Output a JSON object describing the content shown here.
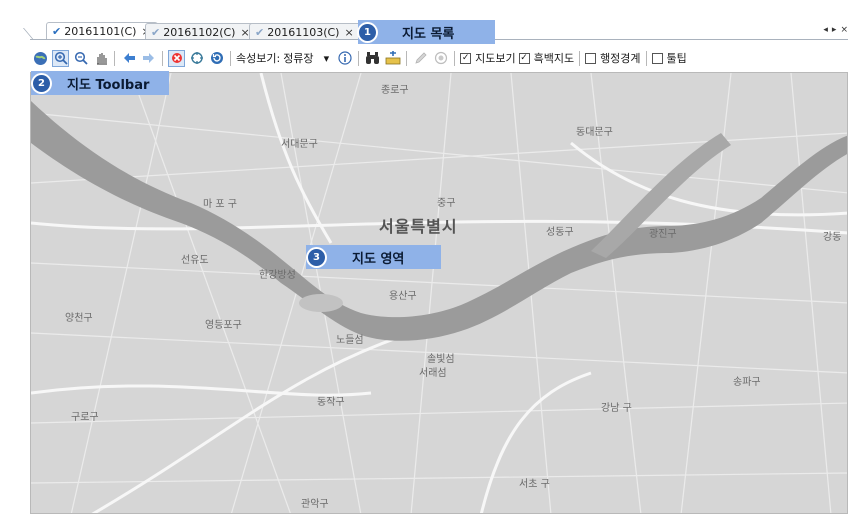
{
  "tabs": [
    {
      "label": "20161101(C)",
      "close": "×",
      "active": true
    },
    {
      "label": "20161102(C)",
      "close": "×",
      "active": false
    },
    {
      "label": "20161103(C)",
      "close": "×",
      "active": false
    }
  ],
  "window_controls": [
    "◂",
    "▸",
    "×"
  ],
  "callouts": {
    "map_list": {
      "number": "1",
      "label": "지도 목록"
    },
    "map_toolbar": {
      "number": "2",
      "label": "지도 Toolbar"
    },
    "map_area": {
      "number": "3",
      "label": "지도 영역"
    }
  },
  "toolbar": {
    "attribute_label": "속성보기:",
    "attribute_value": "정류장",
    "dropdown_arrow": "▾",
    "checkboxes": [
      {
        "label": "지도보기",
        "checked": true
      },
      {
        "label": "흑백지도",
        "checked": true
      },
      {
        "label": "행정경계",
        "checked": false
      },
      {
        "label": "툴팁",
        "checked": false
      }
    ]
  },
  "map_labels": {
    "jongno": "종로구",
    "seodaemun": "서대문구",
    "dongdaemun": "동대문구",
    "mapo": "마 포 구",
    "jung": "중구",
    "seoul": "서울특별시",
    "seongdong": "성동구",
    "gwangjin": "광진구",
    "gangdong": "강동",
    "seonyudo": "선유도",
    "hangang_park": "한강방성",
    "yongsan": "용산구",
    "yangcheon": "양천구",
    "yeongdeungpo": "영등포구",
    "nodeulseom": "노들섬",
    "seorae": "솔빛섬",
    "seoraeseom": "서래섬",
    "songpa": "송파구",
    "guro": "구로구",
    "dongjak": "동작구",
    "gangnam": "강남 구",
    "seocho": "서초 구",
    "gwanak": "관악구"
  },
  "colors": {
    "callout_bg": "#8fb2e8",
    "badge_bg": "#2d5ea8",
    "map_land": "#d6d6d6",
    "map_river": "#9a9a9a",
    "map_road": "#f4f4f4"
  },
  "icons": [
    "globe-icon",
    "zoom-in-icon",
    "zoom-out-icon",
    "pan-hand-icon",
    "back-arrow-icon",
    "forward-arrow-icon",
    "clear-selection-icon",
    "full-extent-icon",
    "refresh-icon",
    "info-icon",
    "binoculars-icon",
    "add-layer-icon",
    "pencil-icon",
    "record-icon"
  ]
}
